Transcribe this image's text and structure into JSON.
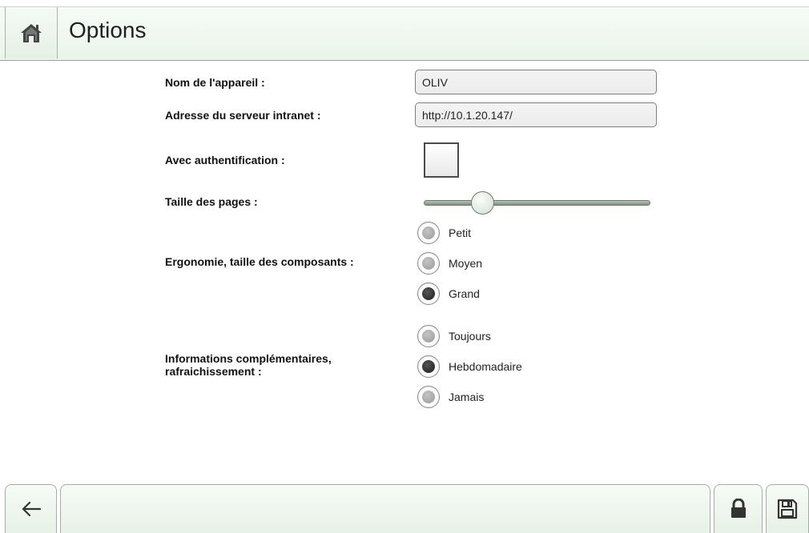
{
  "header": {
    "title": "Options",
    "home_icon": "home-icon"
  },
  "form": {
    "device_name": {
      "label": "Nom de l'appareil :",
      "value": "OLIV"
    },
    "server_address": {
      "label": "Adresse du serveur intranet :",
      "value": "http://10.1.20.147/"
    },
    "authentication": {
      "label": "Avec authentification :",
      "checked": false
    },
    "page_size": {
      "label": "Taille des pages :",
      "value_fraction": 0.23
    },
    "ergonomics": {
      "label": "Ergonomie, taille des composants :",
      "options": [
        "Petit",
        "Moyen",
        "Grand"
      ],
      "selected": "Grand"
    },
    "refresh": {
      "label_line1": "Informations complémentaires,",
      "label_line2": "rafraichissement :",
      "options": [
        "Toujours",
        "Hebdomadaire",
        "Jamais"
      ],
      "selected": "Hebdomadaire"
    }
  },
  "footer": {
    "back_icon": "back-arrow-icon",
    "lock_icon": "lock-icon",
    "save_icon": "save-icon"
  }
}
